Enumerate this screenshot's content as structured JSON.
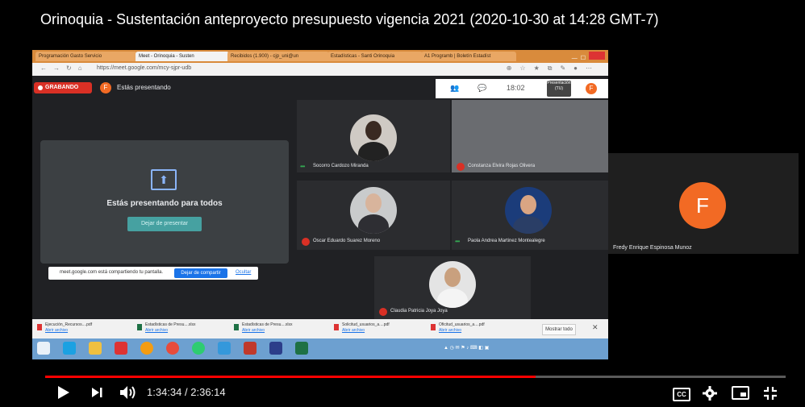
{
  "video": {
    "title": "Orinoquia - Sustentación anteproyecto presupuesto vigencia 2021 (2020-10-30 at 14:28 GMT-7)"
  },
  "browser": {
    "tabs": [
      {
        "label": "Programación Gasto Servicio"
      },
      {
        "label": "Meet - Orinoquia - Susten"
      },
      {
        "label": "Recibidos (1.900) - cjp_uni@un"
      },
      {
        "label": "Estadísticas - Santi Orinoquia"
      },
      {
        "label": "A1 Programb | Boletín Estadíst"
      }
    ],
    "url": "https://meet.google.com/mcy-sjpr-udb"
  },
  "meet": {
    "recording_label": "GRABANDO",
    "user_initial": "F",
    "presenting_label": "Estás presentando",
    "clock": "18:02",
    "presentation_label": "Presentación (TU)",
    "present_message": "Estás presentando para todos",
    "stop_presenting_label": "Dejar de presentar",
    "share_banner": {
      "text": "meet.google.com está compartiendo tu pantalla.",
      "stop_label": "Dejar de compartir",
      "hide_label": "Ocultar"
    },
    "participants": [
      {
        "name": "Socorro Cardozo Miranda"
      },
      {
        "name": "Constanza Elvira Rojas Olivera"
      },
      {
        "name": "Oscar Eduardo Suarez Moreno"
      },
      {
        "name": "Paola Andrea Martinez Montealegre"
      },
      {
        "name": "Claudia Patricia Joya Joya"
      }
    ],
    "side_participant": {
      "name": "Fredy Enrique Espinosa Munoz",
      "initial": "F"
    }
  },
  "downloads": {
    "items": [
      {
        "name": "Ejecución_Recursos....pdf",
        "sub": "Abrir archivo"
      },
      {
        "name": "Estadísticas de Presu....xlsx",
        "sub": "Abrir archivo"
      },
      {
        "name": "Estadísticas de Presu....xlsx",
        "sub": "Abrir archivo"
      },
      {
        "name": "Solicitud_usuarios_a....pdf",
        "sub": "Abrir archivo"
      },
      {
        "name": "Oficitud_usuarios_a....pdf",
        "sub": "Abrir archivo"
      }
    ],
    "show_all_label": "Mostrar todo"
  },
  "player": {
    "current_time": "1:34:34",
    "separator": "/",
    "duration": "2:36:14",
    "progress": 0.662,
    "cc_label": "CC"
  },
  "colors": {
    "progress": "#ff0000",
    "avatar": "#f26a24",
    "record": "#d93025",
    "meet_bg": "#202124"
  }
}
